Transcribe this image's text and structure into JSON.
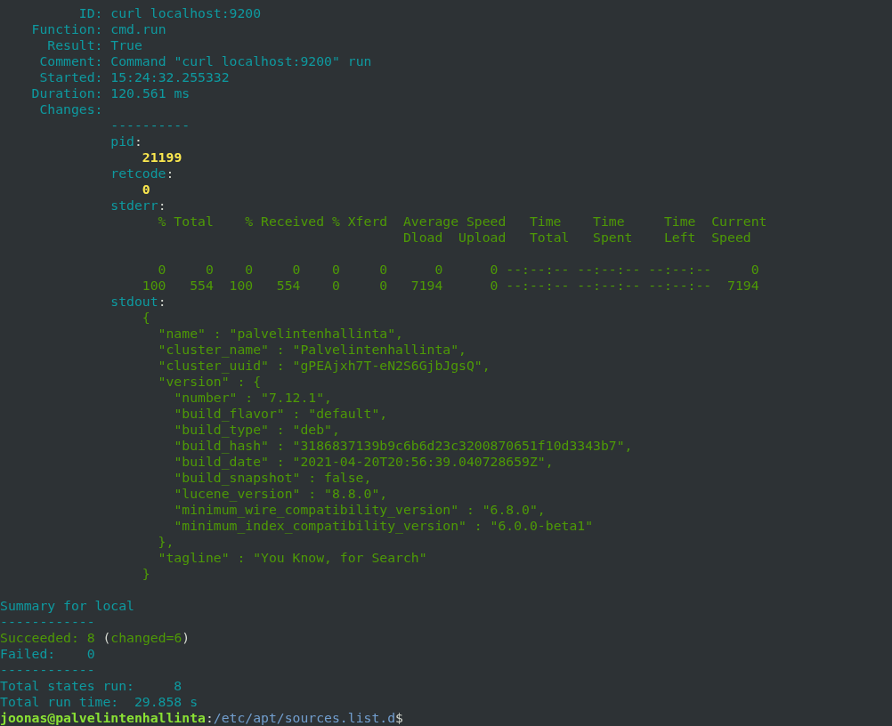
{
  "terminal": {
    "lines": [
      {
        "kind": "text",
        "segments": [
          {
            "kind": "key",
            "text": "          ID:"
          },
          {
            "kind": "value",
            "text": " curl localhost:9200"
          }
        ]
      },
      {
        "kind": "text",
        "segments": [
          {
            "kind": "key",
            "text": "    Function:"
          },
          {
            "kind": "value",
            "text": " cmd.run"
          }
        ]
      },
      {
        "kind": "text",
        "segments": [
          {
            "kind": "key",
            "text": "      Result:"
          },
          {
            "kind": "value",
            "text": " True"
          }
        ]
      },
      {
        "kind": "text",
        "segments": [
          {
            "kind": "key",
            "text": "     Comment:"
          },
          {
            "kind": "value",
            "text": " Command \"curl localhost:9200\" run"
          }
        ]
      },
      {
        "kind": "text",
        "segments": [
          {
            "kind": "key",
            "text": "     Started:"
          },
          {
            "kind": "value",
            "text": " 15:24:32.255332"
          }
        ]
      },
      {
        "kind": "text",
        "segments": [
          {
            "kind": "key",
            "text": "    Duration:"
          },
          {
            "kind": "value",
            "text": " 120.561 ms"
          }
        ]
      },
      {
        "kind": "text",
        "segments": [
          {
            "kind": "key",
            "text": "     Changes:"
          }
        ]
      },
      {
        "kind": "text",
        "segments": [
          {
            "kind": "rule",
            "text": "              ----------"
          }
        ]
      },
      {
        "kind": "text",
        "segments": [
          {
            "kind": "key",
            "text": "              pid"
          },
          {
            "kind": "punct",
            "text": ":"
          }
        ]
      },
      {
        "kind": "text",
        "segments": [
          {
            "kind": "number",
            "text": "                  21199"
          }
        ]
      },
      {
        "kind": "text",
        "segments": [
          {
            "kind": "key",
            "text": "              retcode"
          },
          {
            "kind": "punct",
            "text": ":"
          }
        ]
      },
      {
        "kind": "text",
        "segments": [
          {
            "kind": "number",
            "text": "                  0"
          }
        ]
      },
      {
        "kind": "text",
        "segments": [
          {
            "kind": "key",
            "text": "              stderr"
          },
          {
            "kind": "punct",
            "text": ":"
          }
        ]
      },
      {
        "kind": "text",
        "segments": [
          {
            "kind": "output",
            "text": "                    % Total    % Received % Xferd  Average Speed   Time    Time     Time  Current"
          }
        ]
      },
      {
        "kind": "text",
        "segments": [
          {
            "kind": "output",
            "text": "                                                   Dload  Upload   Total   Spent    Left  Speed"
          }
        ]
      },
      {
        "kind": "blank"
      },
      {
        "kind": "text",
        "segments": [
          {
            "kind": "output",
            "text": "                    0     0    0     0    0     0      0      0 --:--:-- --:--:-- --:--:--     0"
          }
        ]
      },
      {
        "kind": "text",
        "segments": [
          {
            "kind": "output",
            "text": "                  100   554  100   554    0     0   7194      0 --:--:-- --:--:-- --:--:--  7194"
          }
        ]
      },
      {
        "kind": "text",
        "segments": [
          {
            "kind": "key",
            "text": "              stdout"
          },
          {
            "kind": "punct",
            "text": ":"
          }
        ]
      },
      {
        "kind": "text",
        "segments": [
          {
            "kind": "output",
            "text": "                  {"
          }
        ]
      },
      {
        "kind": "text",
        "segments": [
          {
            "kind": "output",
            "text": "                    \"name\" : \"palvelintenhallinta\","
          }
        ]
      },
      {
        "kind": "text",
        "segments": [
          {
            "kind": "output",
            "text": "                    \"cluster_name\" : \"Palvelintenhallinta\","
          }
        ]
      },
      {
        "kind": "text",
        "segments": [
          {
            "kind": "output",
            "text": "                    \"cluster_uuid\" : \"gPEAjxh7T-eN2S6GjbJgsQ\","
          }
        ]
      },
      {
        "kind": "text",
        "segments": [
          {
            "kind": "output",
            "text": "                    \"version\" : {"
          }
        ]
      },
      {
        "kind": "text",
        "segments": [
          {
            "kind": "output",
            "text": "                      \"number\" : \"7.12.1\","
          }
        ]
      },
      {
        "kind": "text",
        "segments": [
          {
            "kind": "output",
            "text": "                      \"build_flavor\" : \"default\","
          }
        ]
      },
      {
        "kind": "text",
        "segments": [
          {
            "kind": "output",
            "text": "                      \"build_type\" : \"deb\","
          }
        ]
      },
      {
        "kind": "text",
        "segments": [
          {
            "kind": "output",
            "text": "                      \"build_hash\" : \"3186837139b9c6b6d23c3200870651f10d3343b7\","
          }
        ]
      },
      {
        "kind": "text",
        "segments": [
          {
            "kind": "output",
            "text": "                      \"build_date\" : \"2021-04-20T20:56:39.040728659Z\","
          }
        ]
      },
      {
        "kind": "text",
        "segments": [
          {
            "kind": "output",
            "text": "                      \"build_snapshot\" : false,"
          }
        ]
      },
      {
        "kind": "text",
        "segments": [
          {
            "kind": "output",
            "text": "                      \"lucene_version\" : \"8.8.0\","
          }
        ]
      },
      {
        "kind": "text",
        "segments": [
          {
            "kind": "output",
            "text": "                      \"minimum_wire_compatibility_version\" : \"6.8.0\","
          }
        ]
      },
      {
        "kind": "text",
        "segments": [
          {
            "kind": "output",
            "text": "                      \"minimum_index_compatibility_version\" : \"6.0.0-beta1\""
          }
        ]
      },
      {
        "kind": "text",
        "segments": [
          {
            "kind": "output",
            "text": "                    },"
          }
        ]
      },
      {
        "kind": "text",
        "segments": [
          {
            "kind": "output",
            "text": "                    \"tagline\" : \"You Know, for Search\""
          }
        ]
      },
      {
        "kind": "text",
        "segments": [
          {
            "kind": "output",
            "text": "                  }"
          }
        ]
      },
      {
        "kind": "blank"
      },
      {
        "kind": "text",
        "segments": [
          {
            "kind": "key",
            "text": "Summary for local"
          }
        ]
      },
      {
        "kind": "text",
        "segments": [
          {
            "kind": "rule",
            "text": "------------"
          }
        ]
      },
      {
        "kind": "text",
        "segments": [
          {
            "kind": "success",
            "text": "Succeeded: 8"
          },
          {
            "kind": "punct",
            "text": " ("
          },
          {
            "kind": "success",
            "text": "changed=6"
          },
          {
            "kind": "punct",
            "text": ")"
          }
        ]
      },
      {
        "kind": "text",
        "segments": [
          {
            "kind": "key",
            "text": "Failed:    0"
          }
        ]
      },
      {
        "kind": "text",
        "segments": [
          {
            "kind": "rule",
            "text": "------------"
          }
        ]
      },
      {
        "kind": "text",
        "segments": [
          {
            "kind": "key",
            "text": "Total states run:     8"
          }
        ]
      },
      {
        "kind": "text",
        "segments": [
          {
            "kind": "key",
            "text": "Total run time:  29.858 s"
          }
        ]
      },
      {
        "kind": "text",
        "segments": [
          {
            "kind": "user",
            "text": "joonas@palvelintenhallinta"
          },
          {
            "kind": "punct",
            "text": ":"
          },
          {
            "kind": "path",
            "text": "/etc/apt/sources.list.d"
          },
          {
            "kind": "punct",
            "text": "$"
          }
        ]
      }
    ]
  }
}
